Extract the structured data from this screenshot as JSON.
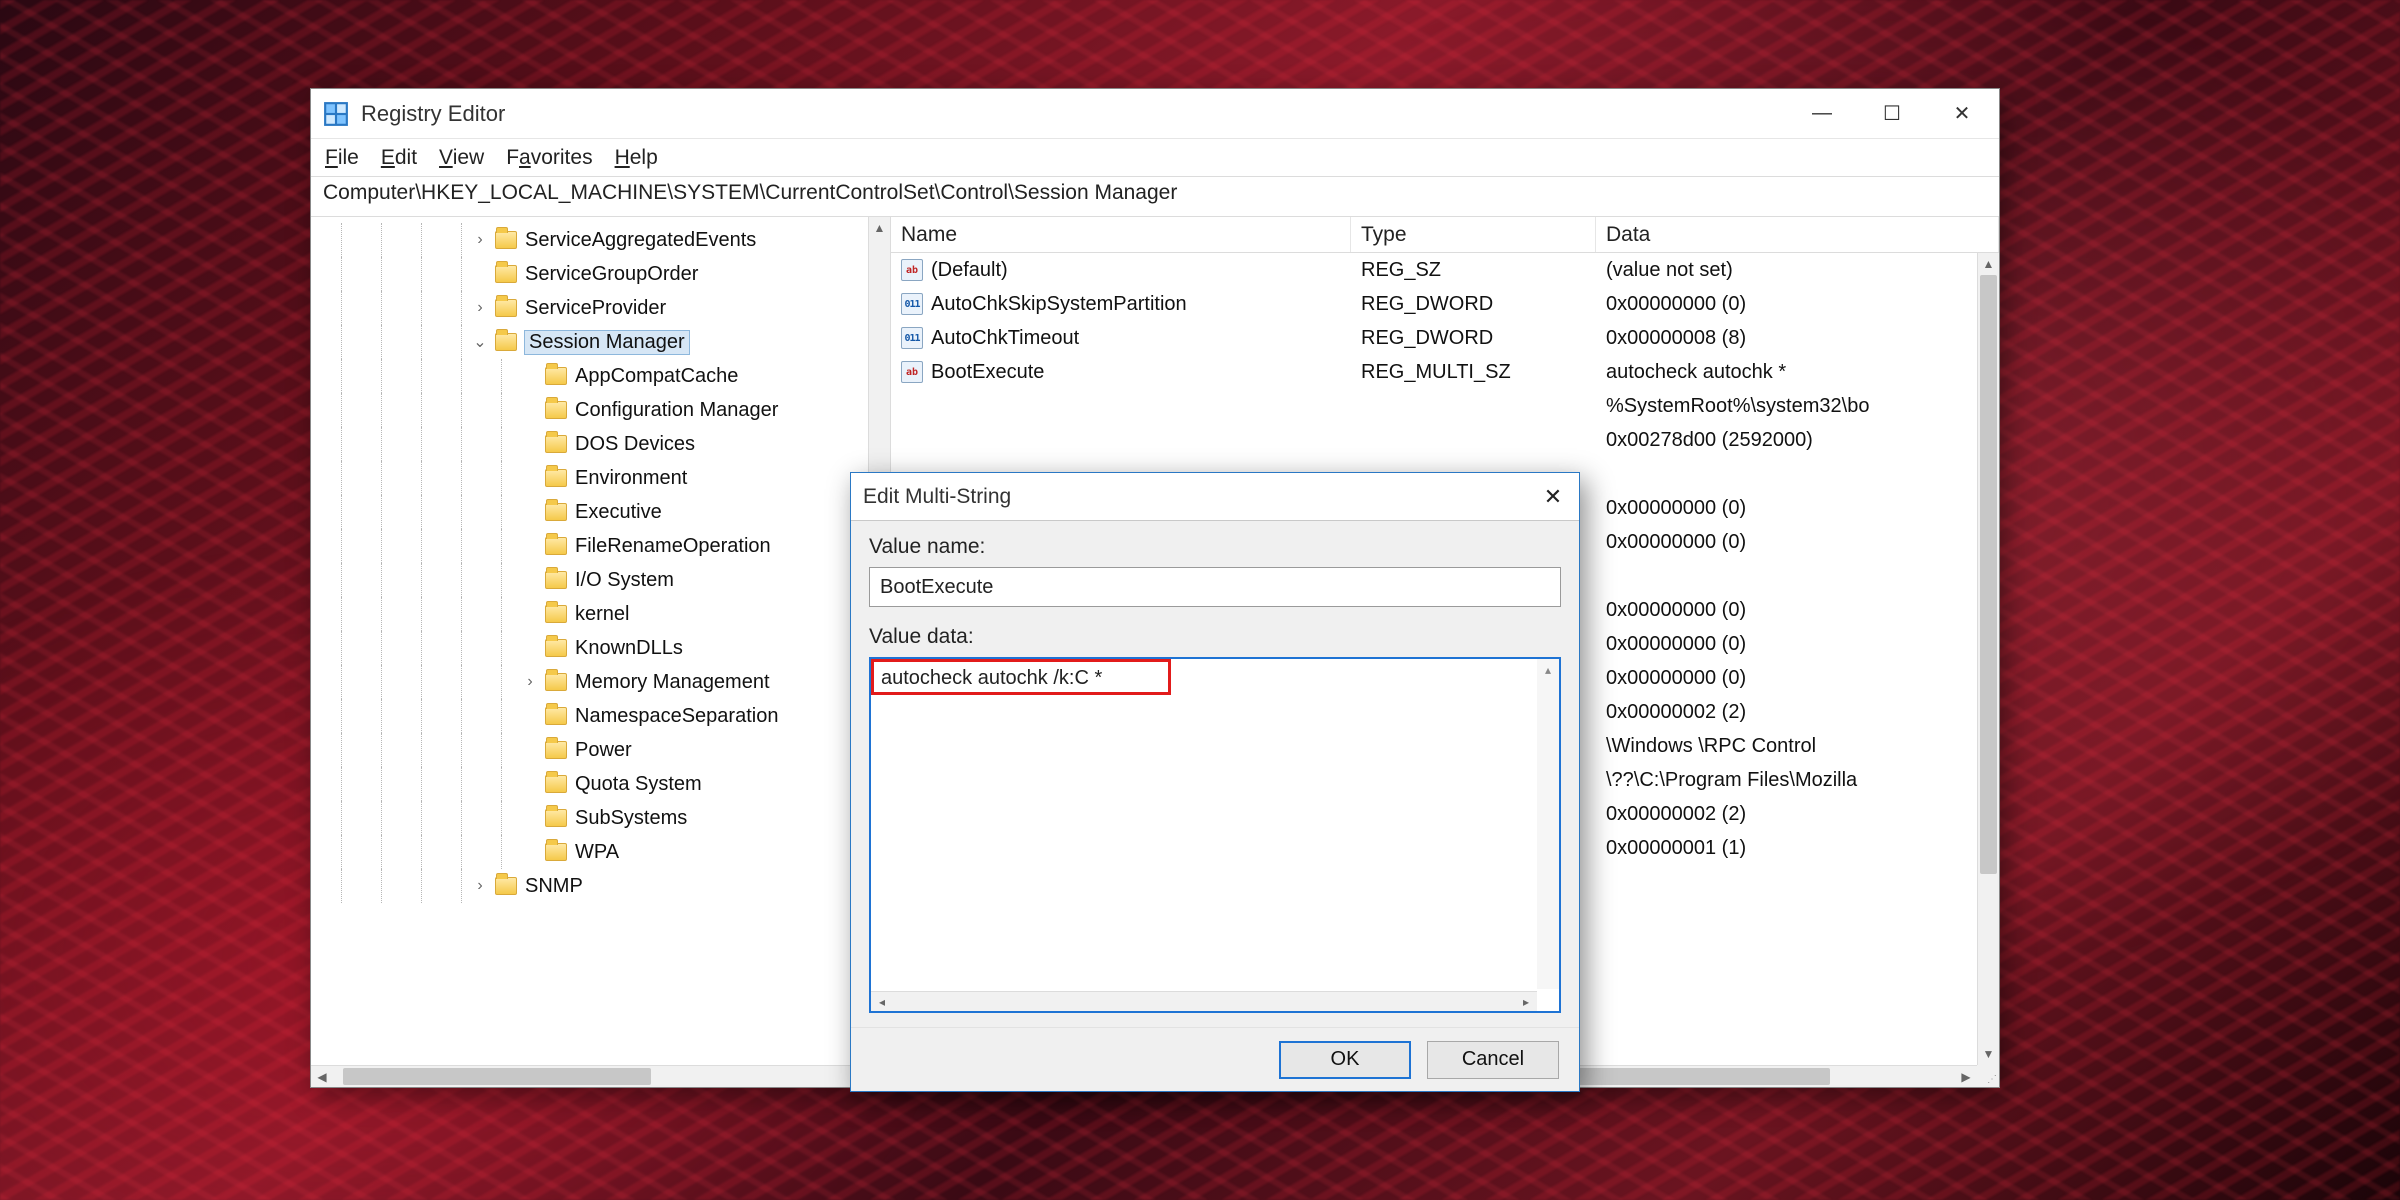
{
  "app": {
    "title": "Registry Editor"
  },
  "menu": {
    "file": "File",
    "edit": "Edit",
    "view": "View",
    "favorites": "Favorites",
    "help": "Help"
  },
  "address": "Computer\\HKEY_LOCAL_MACHINE\\SYSTEM\\CurrentControlSet\\Control\\Session Manager",
  "tree": {
    "items": [
      {
        "label": "ServiceAggregatedEvents",
        "indent": 150,
        "tw": "›"
      },
      {
        "label": "ServiceGroupOrder",
        "indent": 150,
        "tw": ""
      },
      {
        "label": "ServiceProvider",
        "indent": 150,
        "tw": "›"
      },
      {
        "label": "Session Manager",
        "indent": 150,
        "tw": "⌄",
        "selected": true
      },
      {
        "label": "AppCompatCache",
        "indent": 200,
        "tw": ""
      },
      {
        "label": "Configuration Manager",
        "indent": 200,
        "tw": ""
      },
      {
        "label": "DOS Devices",
        "indent": 200,
        "tw": ""
      },
      {
        "label": "Environment",
        "indent": 200,
        "tw": ""
      },
      {
        "label": "Executive",
        "indent": 200,
        "tw": ""
      },
      {
        "label": "FileRenameOperation",
        "indent": 200,
        "tw": ""
      },
      {
        "label": "I/O System",
        "indent": 200,
        "tw": ""
      },
      {
        "label": "kernel",
        "indent": 200,
        "tw": ""
      },
      {
        "label": "KnownDLLs",
        "indent": 200,
        "tw": ""
      },
      {
        "label": "Memory Management",
        "indent": 200,
        "tw": "›"
      },
      {
        "label": "NamespaceSeparation",
        "indent": 200,
        "tw": ""
      },
      {
        "label": "Power",
        "indent": 200,
        "tw": ""
      },
      {
        "label": "Quota System",
        "indent": 200,
        "tw": ""
      },
      {
        "label": "SubSystems",
        "indent": 200,
        "tw": ""
      },
      {
        "label": "WPA",
        "indent": 200,
        "tw": ""
      },
      {
        "label": "SNMP",
        "indent": 150,
        "tw": "›"
      }
    ]
  },
  "list": {
    "headers": {
      "name": "Name",
      "type": "Type",
      "data": "Data"
    },
    "rows": [
      {
        "icon": "str",
        "name": "(Default)",
        "type": "REG_SZ",
        "data": "(value not set)"
      },
      {
        "icon": "bin",
        "name": "AutoChkSkipSystemPartition",
        "type": "REG_DWORD",
        "data": "0x00000000 (0)"
      },
      {
        "icon": "bin",
        "name": "AutoChkTimeout",
        "type": "REG_DWORD",
        "data": "0x00000008 (8)"
      },
      {
        "icon": "str",
        "name": "BootExecute",
        "type": "REG_MULTI_SZ",
        "data": "autocheck autochk *"
      },
      {
        "icon": "",
        "name": "",
        "type": "",
        "data": "%SystemRoot%\\system32\\bo"
      },
      {
        "icon": "",
        "name": "",
        "type": "",
        "data": "0x00278d00 (2592000)"
      },
      {
        "icon": "",
        "name": "",
        "type": "",
        "data": ""
      },
      {
        "icon": "",
        "name": "",
        "type": "",
        "data": "0x00000000 (0)"
      },
      {
        "icon": "",
        "name": "",
        "type": "",
        "data": "0x00000000 (0)"
      },
      {
        "icon": "",
        "name": "",
        "type": "",
        "data": ""
      },
      {
        "icon": "",
        "name": "",
        "type": "",
        "data": "0x00000000 (0)"
      },
      {
        "icon": "",
        "name": "",
        "type": "",
        "data": "0x00000000 (0)"
      },
      {
        "icon": "",
        "name": "",
        "type": "",
        "data": "0x00000000 (0)"
      },
      {
        "icon": "",
        "name": "",
        "type": "",
        "data": "0x00000002 (2)"
      },
      {
        "icon": "",
        "name": "",
        "type": "",
        "data": "\\Windows \\RPC Control"
      },
      {
        "icon": "",
        "name": "",
        "type": "",
        "data": "\\??\\C:\\Program Files\\Mozilla"
      },
      {
        "icon": "",
        "name": "",
        "type": "",
        "data": "0x00000002 (2)"
      },
      {
        "icon": "",
        "name": "",
        "type": "",
        "data": "0x00000001 (1)"
      }
    ]
  },
  "dialog": {
    "title": "Edit Multi-String",
    "value_name_label": "Value name:",
    "value_name": "BootExecute",
    "value_data_label": "Value data:",
    "value_data": "autocheck autochk /k:C *",
    "ok": "OK",
    "cancel": "Cancel"
  }
}
